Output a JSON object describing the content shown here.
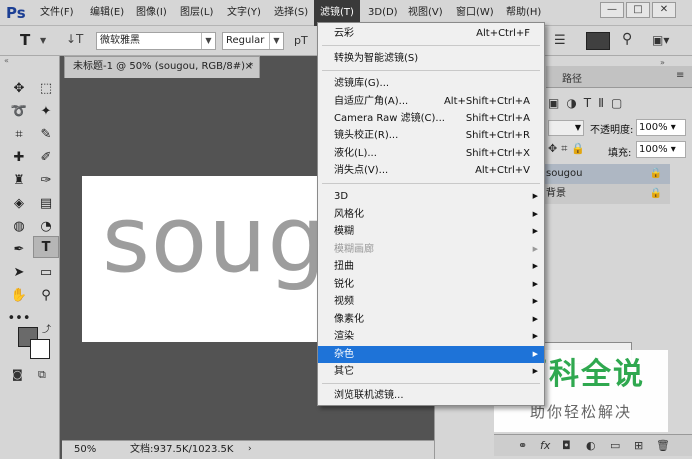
{
  "app": {
    "logo": "Ps"
  },
  "menubar": {
    "items": [
      "文件(F)",
      "编辑(E)",
      "图像(I)",
      "图层(L)",
      "文字(Y)",
      "选择(S)",
      "滤镜(T)",
      "3D(D)",
      "视图(V)",
      "窗口(W)",
      "帮助(H)"
    ],
    "win_min": "—",
    "win_max": "□",
    "win_close": "✕"
  },
  "options": {
    "tool_glyph": "T",
    "font_family": "微软雅黑",
    "font_style": "Regular",
    "size_prefix": "pT"
  },
  "document": {
    "tab_title": "未标题-1 @ 50% (sougou, RGB/8#) *",
    "tab_close": "×",
    "canvas_text": "sougou",
    "zoom": "50%",
    "doc_info": "文档:937.5K/1023.5K"
  },
  "panel": {
    "tab_paths": "路径",
    "opacity_label": "不透明度:",
    "opacity_value": "100%",
    "fill_label": "填充:",
    "fill_value": "100%",
    "layers": [
      "sougou",
      "背景"
    ]
  },
  "filter_menu": {
    "items": [
      {
        "label": "云彩",
        "shortcut": "Alt+Ctrl+F"
      },
      {
        "label": "转换为智能滤镜(S)",
        "shortcut": ""
      },
      {
        "label": "滤镜库(G)...",
        "shortcut": ""
      },
      {
        "label": "自适应广角(A)...",
        "shortcut": "Alt+Shift+Ctrl+A"
      },
      {
        "label": "Camera Raw 滤镜(C)...",
        "shortcut": "Shift+Ctrl+A"
      },
      {
        "label": "镜头校正(R)...",
        "shortcut": "Shift+Ctrl+R"
      },
      {
        "label": "液化(L)...",
        "shortcut": "Shift+Ctrl+X"
      },
      {
        "label": "消失点(V)...",
        "shortcut": "Alt+Ctrl+V"
      },
      {
        "label": "3D",
        "submenu": true
      },
      {
        "label": "风格化",
        "submenu": true
      },
      {
        "label": "模糊",
        "submenu": true
      },
      {
        "label": "模糊画廊",
        "submenu": true,
        "disabled": true
      },
      {
        "label": "扭曲",
        "submenu": true
      },
      {
        "label": "锐化",
        "submenu": true
      },
      {
        "label": "视频",
        "submenu": true
      },
      {
        "label": "像素化",
        "submenu": true
      },
      {
        "label": "渲染",
        "submenu": true
      },
      {
        "label": "杂色",
        "submenu": true,
        "highlighted": true
      },
      {
        "label": "其它",
        "submenu": true
      },
      {
        "label": "浏览联机滤镜...",
        "shortcut": ""
      }
    ]
  },
  "watermark": {
    "title": "百科全说",
    "subtitle": "助你轻松解决"
  },
  "colors": {
    "menu_highlight": "#1e73d8",
    "watermark_green": "#2fa84f"
  }
}
